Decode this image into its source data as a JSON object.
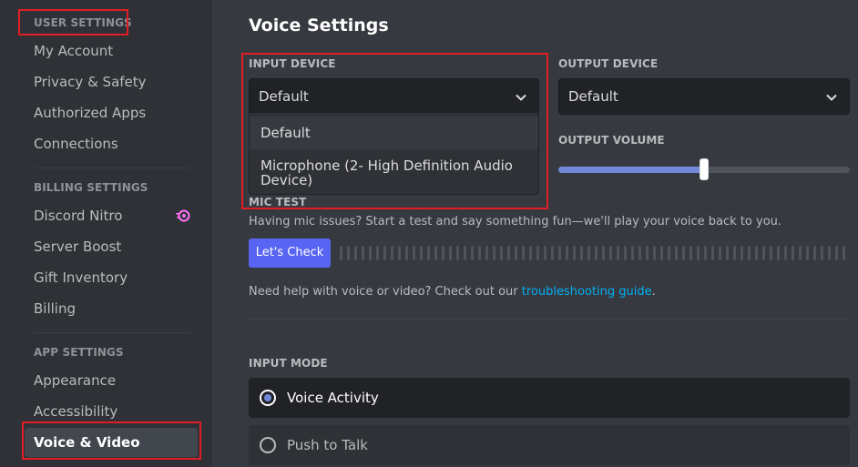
{
  "sidebar": {
    "sections": [
      {
        "header": "USER SETTINGS",
        "items": [
          "My Account",
          "Privacy & Safety",
          "Authorized Apps",
          "Connections"
        ]
      },
      {
        "header": "BILLING SETTINGS",
        "items": [
          "Discord Nitro",
          "Server Boost",
          "Gift Inventory",
          "Billing"
        ]
      },
      {
        "header": "APP SETTINGS",
        "items": [
          "Appearance",
          "Accessibility",
          "Voice & Video"
        ]
      }
    ],
    "selected_item": "Voice & Video"
  },
  "main": {
    "title": "Voice Settings",
    "input_device": {
      "label": "INPUT DEVICE",
      "value": "Default",
      "options": [
        "Default",
        "Microphone (2- High Definition Audio Device)"
      ]
    },
    "output_device": {
      "label": "OUTPUT DEVICE",
      "value": "Default"
    },
    "output_volume": {
      "label": "OUTPUT VOLUME",
      "value_percent": 50
    },
    "mic_test": {
      "label": "MIC TEST",
      "description": "Having mic issues? Start a test and say something fun—we'll play your voice back to you.",
      "button": "Let's Check"
    },
    "help": {
      "text": "Need help with voice or video? Check out our ",
      "link": "troubleshooting guide",
      "suffix": "."
    },
    "input_mode": {
      "label": "INPUT MODE",
      "options": [
        "Voice Activity",
        "Push to Talk"
      ],
      "selected": "Voice Activity"
    }
  },
  "colors": {
    "accent": "#5865f2",
    "slider": "#7289da",
    "link": "#00aff4",
    "highlight": "#e01e24"
  }
}
